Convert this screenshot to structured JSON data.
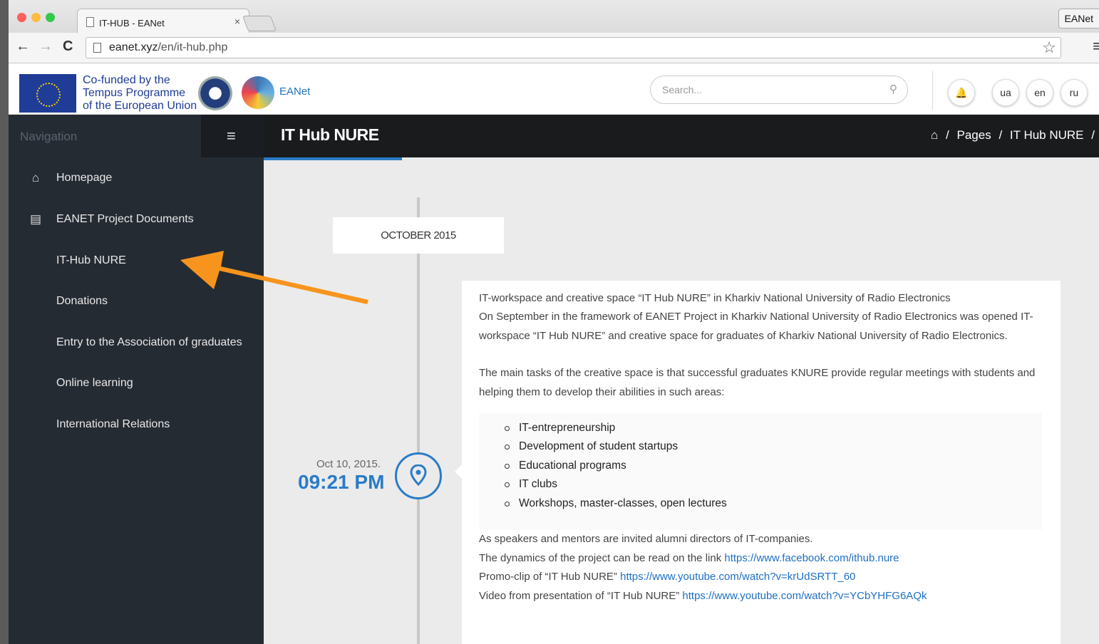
{
  "browser": {
    "tab_title": "IT-HUB - EANet",
    "tab_close": "×",
    "profile_label": "EANet",
    "url_host": "eanet.xyz",
    "url_path": "/en/it-hub.php"
  },
  "header": {
    "eu_line1": "Co-funded by the",
    "eu_line2": "Tempus Programme",
    "eu_line3": "of the European Union",
    "brand": "EANet",
    "search_placeholder": "Search...",
    "lang_ua": "ua",
    "lang_en": "en",
    "lang_ru": "ru"
  },
  "sidebar": {
    "heading": "Navigation",
    "items": [
      {
        "label": "Homepage"
      },
      {
        "label": "EANET Project Documents"
      },
      {
        "label": "IT-Hub NURE"
      },
      {
        "label": "Donations"
      },
      {
        "label": "Entry to the Association of graduates"
      },
      {
        "label": "Online learning"
      },
      {
        "label": "International Relations"
      }
    ]
  },
  "page": {
    "title": "IT Hub NURE",
    "crumb_sep": "/",
    "crumb_pages": "Pages",
    "crumb_current": "IT Hub NURE"
  },
  "timeline": {
    "month": "OCTOBER 2015",
    "date": "Oct 10, 2015.",
    "time": "09:21 PM",
    "p1": "IT-workspace and creative space “IT Hub NURE” in Kharkiv National University of Radio Electronics",
    "p2": "On September in the framework of EANET Project in Kharkiv National University of Radio Electronics was opened IT-workspace “IT Hub NURE” and creative space for graduates of Kharkiv National University of Radio Electronics.",
    "p3": "The main tasks of the creative space is that successful graduates KNURE provide regular meetings with students and helping them to develop their abilities in such areas:",
    "list": [
      "IT-entrepreneurship",
      "Development of student startups",
      "Educational programs",
      "IT clubs",
      "Workshops, master-classes, open lectures"
    ],
    "p4": "As speakers and mentors are invited alumni directors of IT-companies.",
    "p5_text": "The dynamics of the project can be read on the link ",
    "p5_link": "https://www.facebook.com/ithub.nure",
    "p6_text": "Promo-clip of “IT Hub NURE” ",
    "p6_link": "https://www.youtube.com/watch?v=krUdSRTT_60",
    "p7_text": "Video from presentation of “IT Hub NURE” ",
    "p7_link": "https://www.youtube.com/watch?v=YCbYHFG6AQk"
  },
  "colors": {
    "accent": "#2a7cc7",
    "sidebar": "#252b33",
    "arrow": "#f7941d"
  }
}
